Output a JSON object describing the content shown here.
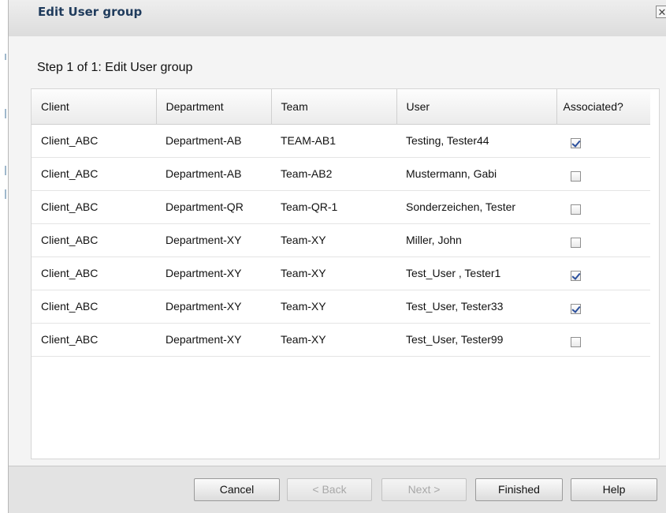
{
  "dialog": {
    "title": "Edit User group",
    "close_label": "✕"
  },
  "step": {
    "title": "Step 1 of 1: Edit User group"
  },
  "table": {
    "columns": [
      "Client",
      "Department",
      "Team",
      "User",
      "Associated?"
    ],
    "rows": [
      {
        "client": "Client_ABC",
        "department": "Department-AB",
        "team": "TEAM-AB1",
        "user": "Testing, Tester44",
        "associated": true
      },
      {
        "client": "Client_ABC",
        "department": "Department-AB",
        "team": "Team-AB2",
        "user": "Mustermann, Gabi",
        "associated": false
      },
      {
        "client": "Client_ABC",
        "department": "Department-QR",
        "team": "Team-QR-1",
        "user": "Sonderzeichen, Tester",
        "associated": false
      },
      {
        "client": "Client_ABC",
        "department": "Department-XY",
        "team": "Team-XY",
        "user": "Miller, John",
        "associated": false
      },
      {
        "client": "Client_ABC",
        "department": "Department-XY",
        "team": "Team-XY",
        "user": "Test_User , Tester1",
        "associated": true
      },
      {
        "client": "Client_ABC",
        "department": "Department-XY",
        "team": "Team-XY",
        "user": "Test_User, Tester33",
        "associated": true
      },
      {
        "client": "Client_ABC",
        "department": "Department-XY",
        "team": "Team-XY",
        "user": "Test_User, Tester99",
        "associated": false
      }
    ]
  },
  "footer": {
    "cancel_label": "Cancel",
    "back_label": "< Back",
    "next_label": "Next >",
    "finished_label": "Finished",
    "help_label": "Help"
  },
  "colors": {
    "title_text": "#1f3b5c",
    "checkmark": "#2b4f9c"
  }
}
